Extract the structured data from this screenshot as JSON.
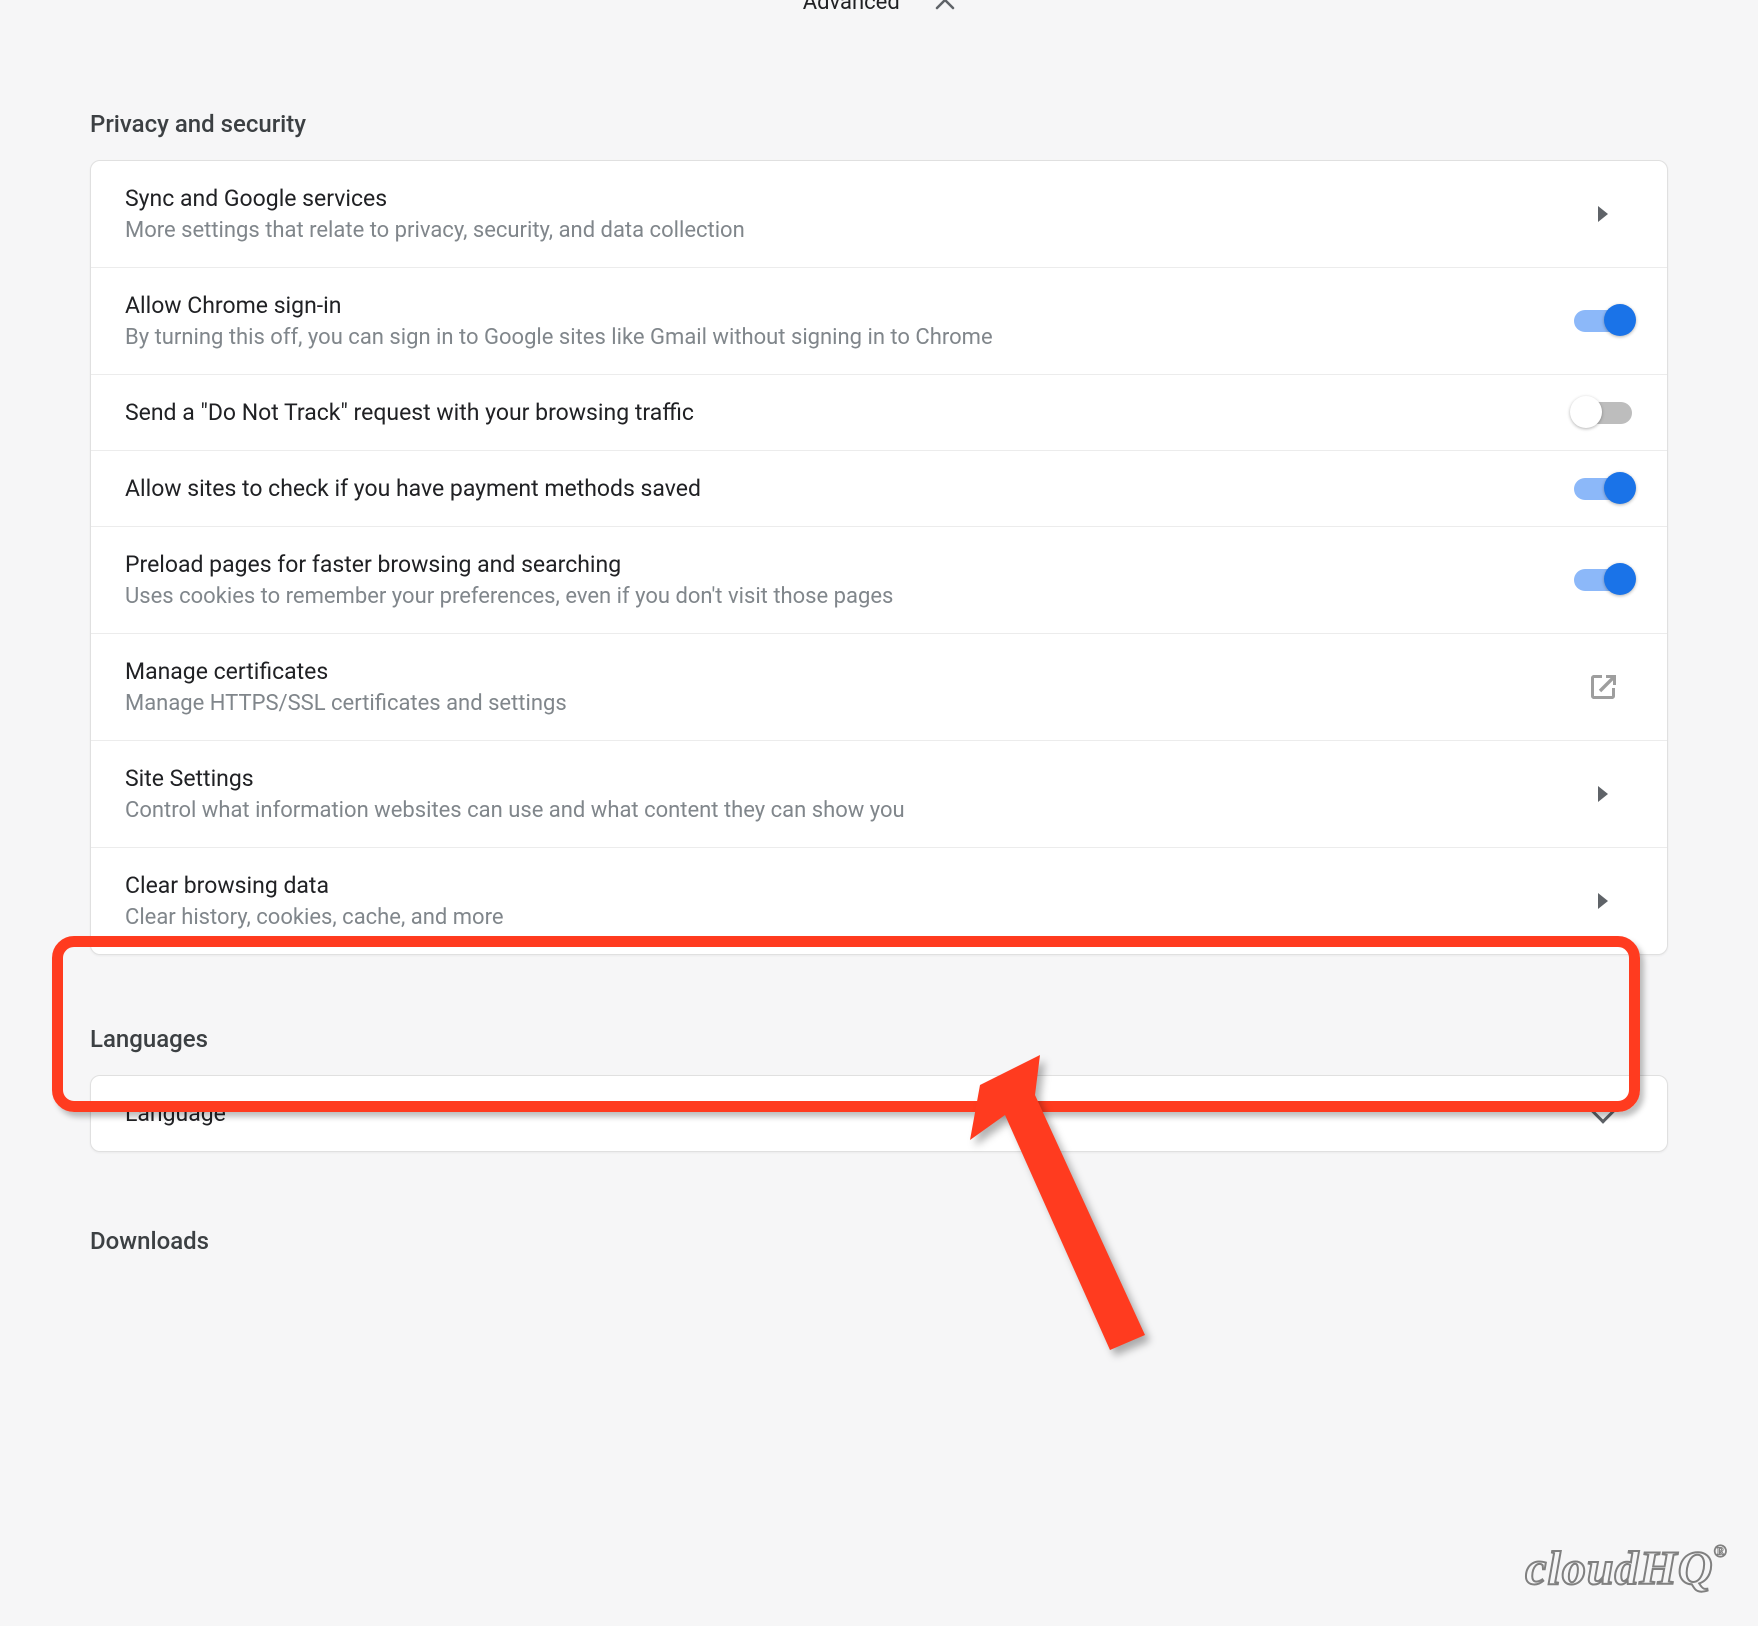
{
  "top": {
    "advanced_label": "Advanced"
  },
  "sections": {
    "privacy_heading": "Privacy and security",
    "languages_heading": "Languages",
    "downloads_heading": "Downloads"
  },
  "privacy": {
    "sync": {
      "title": "Sync and Google services",
      "desc": "More settings that relate to privacy, security, and data collection"
    },
    "signin": {
      "title": "Allow Chrome sign-in",
      "desc": "By turning this off, you can sign in to Google sites like Gmail without signing in to Chrome",
      "on": true
    },
    "dnt": {
      "title": "Send a \"Do Not Track\" request with your browsing traffic",
      "on": false
    },
    "payment": {
      "title": "Allow sites to check if you have payment methods saved",
      "on": true
    },
    "preload": {
      "title": "Preload pages for faster browsing and searching",
      "desc": "Uses cookies to remember your preferences, even if you don't visit those pages",
      "on": true
    },
    "certs": {
      "title": "Manage certificates",
      "desc": "Manage HTTPS/SSL certificates and settings"
    },
    "site": {
      "title": "Site Settings",
      "desc": "Control what information websites can use and what content they can show you"
    },
    "clear": {
      "title": "Clear browsing data",
      "desc": "Clear history, cookies, cache, and more"
    }
  },
  "languages": {
    "language_row": "Language"
  },
  "watermark": "cloudHQ"
}
